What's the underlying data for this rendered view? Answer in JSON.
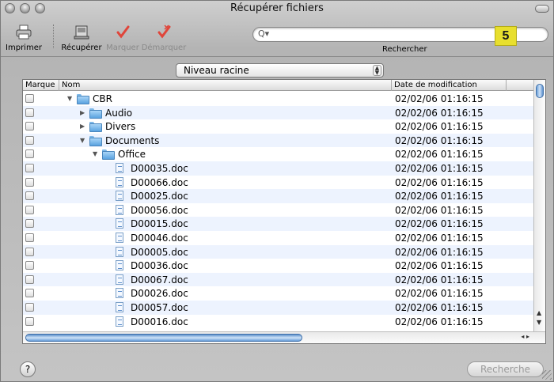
{
  "window": {
    "title": "Récupérer fichiers"
  },
  "toolbar": {
    "print_label": "Imprimer",
    "recover_label": "Récupérer",
    "mark_label": "Marquer",
    "unmark_label": "Démarquer",
    "search_label": "Rechercher",
    "search_value": ""
  },
  "badge": "5",
  "level": {
    "value": "Niveau racine"
  },
  "columns": {
    "mark": "Marque",
    "name": "Nom",
    "date": "Date de modification"
  },
  "rows": [
    {
      "name": "CBR",
      "type": "folder",
      "expanded": true,
      "depth": 0,
      "date": "02/02/06 01:16:15"
    },
    {
      "name": "Audio",
      "type": "folder",
      "expanded": false,
      "depth": 1,
      "date": "02/02/06 01:16:15"
    },
    {
      "name": "Divers",
      "type": "folder",
      "expanded": false,
      "depth": 1,
      "date": "02/02/06 01:16:15"
    },
    {
      "name": "Documents",
      "type": "folder",
      "expanded": true,
      "depth": 1,
      "date": "02/02/06 01:16:15"
    },
    {
      "name": "Office",
      "type": "folder",
      "expanded": true,
      "depth": 2,
      "date": "02/02/06 01:16:15"
    },
    {
      "name": "D00035.doc",
      "type": "file",
      "depth": 3,
      "date": "02/02/06 01:16:15"
    },
    {
      "name": "D00066.doc",
      "type": "file",
      "depth": 3,
      "date": "02/02/06 01:16:15"
    },
    {
      "name": "D00025.doc",
      "type": "file",
      "depth": 3,
      "date": "02/02/06 01:16:15"
    },
    {
      "name": "D00056.doc",
      "type": "file",
      "depth": 3,
      "date": "02/02/06 01:16:15"
    },
    {
      "name": "D00015.doc",
      "type": "file",
      "depth": 3,
      "date": "02/02/06 01:16:15"
    },
    {
      "name": "D00046.doc",
      "type": "file",
      "depth": 3,
      "date": "02/02/06 01:16:15"
    },
    {
      "name": "D00005.doc",
      "type": "file",
      "depth": 3,
      "date": "02/02/06 01:16:15"
    },
    {
      "name": "D00036.doc",
      "type": "file",
      "depth": 3,
      "date": "02/02/06 01:16:15"
    },
    {
      "name": "D00067.doc",
      "type": "file",
      "depth": 3,
      "date": "02/02/06 01:16:15"
    },
    {
      "name": "D00026.doc",
      "type": "file",
      "depth": 3,
      "date": "02/02/06 01:16:15"
    },
    {
      "name": "D00057.doc",
      "type": "file",
      "depth": 3,
      "date": "02/02/06 01:16:15"
    },
    {
      "name": "D00016.doc",
      "type": "file",
      "depth": 3,
      "date": "02/02/06 01:16:15"
    }
  ],
  "footer": {
    "help_label": "?",
    "search_button_label": "Recherche"
  },
  "icons": {
    "print": "printer-icon",
    "recover": "drive-icon",
    "mark": "checkmark-icon",
    "unmark": "checkmark-cross-icon",
    "search": "magnifier-icon",
    "folder": "folder-icon",
    "file": "document-icon"
  },
  "colors": {
    "badge": "#e8df2e",
    "mark_icon": "#e0453a",
    "folder": "#5aa3e0",
    "row_stripe": "#edf3fe"
  }
}
